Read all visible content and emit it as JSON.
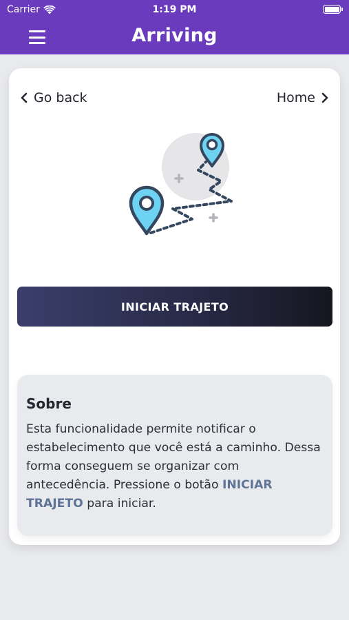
{
  "status_bar": {
    "carrier": "Carrier",
    "time": "1:19 PM",
    "wifi_icon": "wifi-icon",
    "battery_icon": "battery-icon"
  },
  "nav": {
    "title": "Arriving",
    "menu_icon": "hamburger-menu-icon",
    "bar_color": "#6a3bbd"
  },
  "links": {
    "back_label": "Go back",
    "back_icon": "chevron-left-icon",
    "home_label": "Home",
    "home_icon": "chevron-right-icon"
  },
  "illustration_icon": "route-map-pins-icon",
  "action": {
    "start_label": "INICIAR TRAJETO"
  },
  "about": {
    "title": "Sobre",
    "text_before": "Esta funcionalidade permite notificar o estabelecimento que você está a caminho. Dessa forma conseguem se organizar com antecedência. Pressione o botão ",
    "highlight": "INICIAR TRAJETO",
    "text_after": " para iniciar.",
    "highlight_color": "#5e7395"
  },
  "colors": {
    "pin_fill": "#6ed3f2",
    "outline": "#34475f",
    "background": "#e9eaee"
  }
}
